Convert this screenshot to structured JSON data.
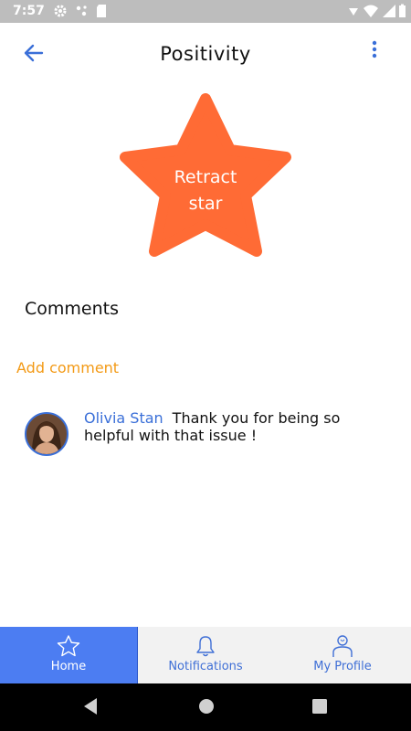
{
  "status_bar": {
    "time": "7:57"
  },
  "app_bar": {
    "title": "Positivity"
  },
  "star_button": {
    "label_line1": "Retract",
    "label_line2": "star",
    "color": "#ff6b35"
  },
  "comments": {
    "heading": "Comments",
    "add_label": "Add comment",
    "items": [
      {
        "author": "Olivia Stan",
        "text": "Thank you for being so helpful with that issue !"
      }
    ]
  },
  "bottom_nav": {
    "items": [
      {
        "label": "Home",
        "icon": "star-outline-icon",
        "active": true
      },
      {
        "label": "Notifications",
        "icon": "bell-icon",
        "active": false
      },
      {
        "label": "My Profile",
        "icon": "person-icon",
        "active": false
      }
    ]
  },
  "colors": {
    "accent_blue": "#3a6fd8",
    "active_tab": "#4c7df2",
    "add_comment": "#f39a16"
  }
}
